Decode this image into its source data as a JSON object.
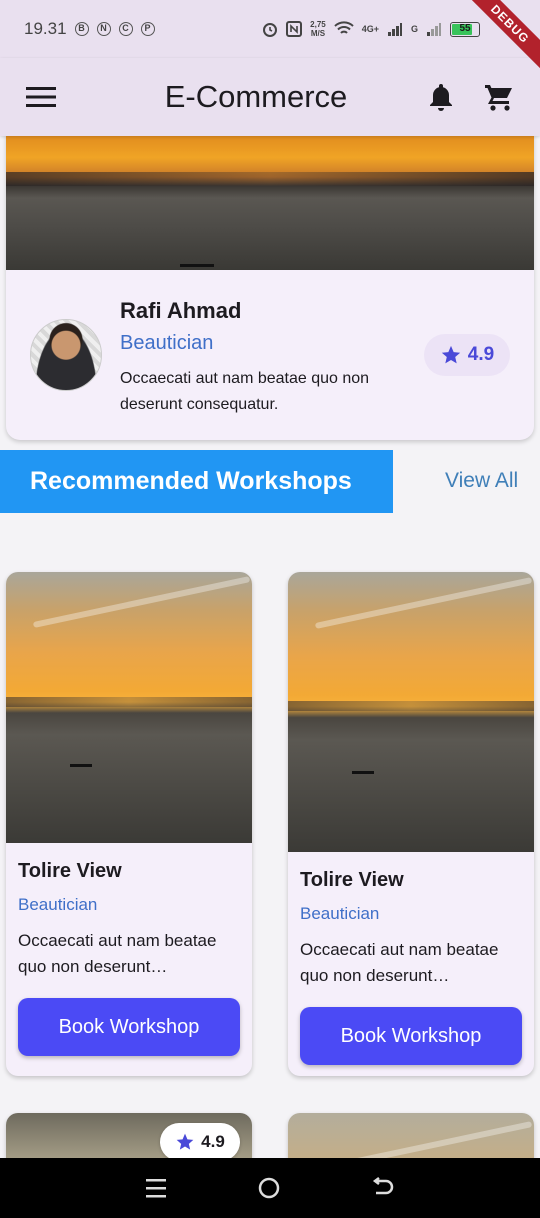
{
  "status_bar": {
    "time": "19.31",
    "left_icons": [
      "B",
      "N",
      "C",
      "P"
    ],
    "speed_top": "2,75",
    "speed_bottom": "M/S",
    "network_label": "4G+",
    "network_label2": "G",
    "battery": "55"
  },
  "debug_banner": "DEBUG",
  "app_bar": {
    "title": "E-Commerce",
    "icons": [
      "menu-icon",
      "bell-icon",
      "cart-icon"
    ]
  },
  "featured": {
    "name": "Rafi Ahmad",
    "role": "Beautician",
    "description": "Occaecati aut nam beatae quo non deserunt consequatur.",
    "rating": "4.9"
  },
  "section": {
    "title": "Recommended Workshops",
    "view_all": "View All"
  },
  "workshops": [
    {
      "title": "Tolire View",
      "role": "Beautician",
      "description": "Occaecati aut nam beatae quo non deserunt consequatur.",
      "button": "Book Workshop"
    },
    {
      "title": "Tolire View",
      "role": "Beautician",
      "description": "Occaecati aut nam beatae quo non deserunt consequatur.",
      "button": "Book Workshop"
    }
  ],
  "partial_card": {
    "rating": "4.9"
  },
  "colors": {
    "app_bar_bg": "#e9e0ef",
    "accent_blue": "#2196f3",
    "button_indigo": "#4b4af5",
    "role_blue": "#3f6fc8"
  }
}
